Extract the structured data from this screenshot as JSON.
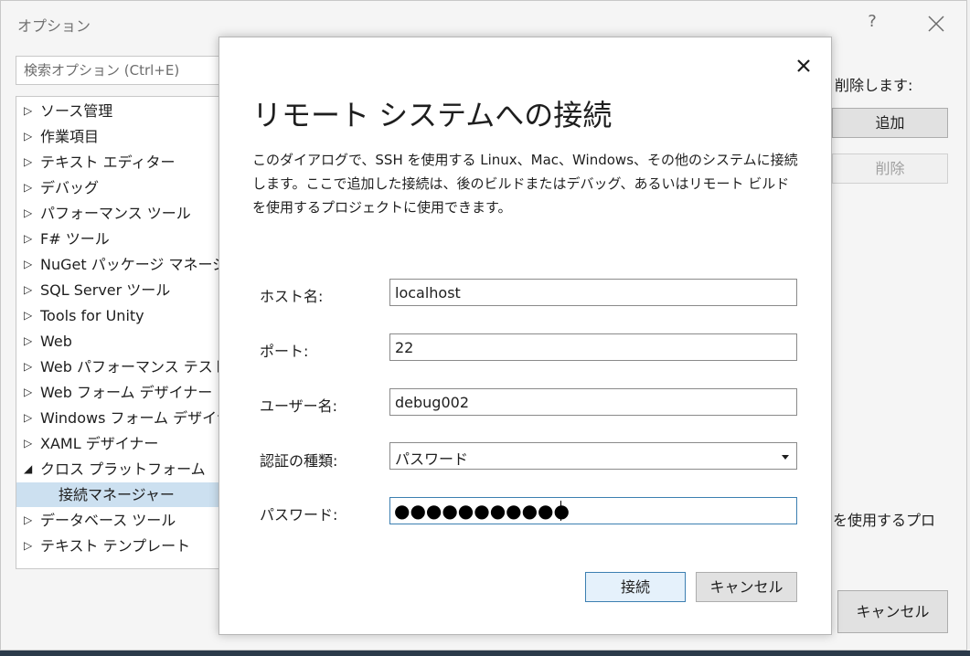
{
  "window": {
    "title": "オプション",
    "help_label": "?"
  },
  "search": {
    "placeholder": "検索オプション (Ctrl+E)"
  },
  "tree": {
    "items": [
      {
        "label": "ソース管理",
        "expander": "▷"
      },
      {
        "label": "作業項目",
        "expander": "▷"
      },
      {
        "label": "テキスト エディター",
        "expander": "▷"
      },
      {
        "label": "デバッグ",
        "expander": "▷"
      },
      {
        "label": "パフォーマンス ツール",
        "expander": "▷"
      },
      {
        "label": "F# ツール",
        "expander": "▷"
      },
      {
        "label": "NuGet パッケージ マネージャー",
        "expander": "▷"
      },
      {
        "label": "SQL Server ツール",
        "expander": "▷"
      },
      {
        "label": "Tools for Unity",
        "expander": "▷"
      },
      {
        "label": "Web",
        "expander": "▷"
      },
      {
        "label": "Web パフォーマンス テスト ツール",
        "expander": "▷"
      },
      {
        "label": "Web フォーム デザイナー",
        "expander": "▷"
      },
      {
        "label": "Windows フォーム デザイナー",
        "expander": "▷"
      },
      {
        "label": "XAML デザイナー",
        "expander": "▷"
      },
      {
        "label": "クロス プラットフォーム",
        "expander": "◢"
      },
      {
        "label": "接続マネージャー",
        "expander": ""
      },
      {
        "label": "データベース ツール",
        "expander": "▷"
      },
      {
        "label": "テキスト テンプレート",
        "expander": "▷"
      }
    ]
  },
  "background_panel": {
    "delete_label": "削除します:",
    "add_button": "追加",
    "remove_button": "削除",
    "use_text": "を使用するプロ",
    "cancel_button": "キャンセル"
  },
  "dialog": {
    "title": "リモート システムへの接続",
    "description": "このダイアログで、SSH を使用する Linux、Mac、Windows、その他のシステムに接続します。ここで追加した接続は、後のビルドまたはデバッグ、あるいはリモート ビルドを使用するプロジェクトに使用できます。",
    "fields": {
      "host": {
        "label": "ホスト名:",
        "value": "localhost"
      },
      "port": {
        "label": "ポート:",
        "value": "22"
      },
      "user": {
        "label": "ユーザー名:",
        "value": "debug002"
      },
      "auth": {
        "label": "認証の種類:",
        "value": "パスワード"
      },
      "password": {
        "label": "パスワード:",
        "mask": "●●●●●●●●●●●"
      }
    },
    "connect_button": "接続",
    "cancel_button": "キャンセル"
  },
  "colors": {
    "accent": "#3c7fb1",
    "selected_row": "#cce0f0"
  },
  "icons": {
    "close": "close-icon",
    "dropdown": "chevron-down-icon"
  }
}
